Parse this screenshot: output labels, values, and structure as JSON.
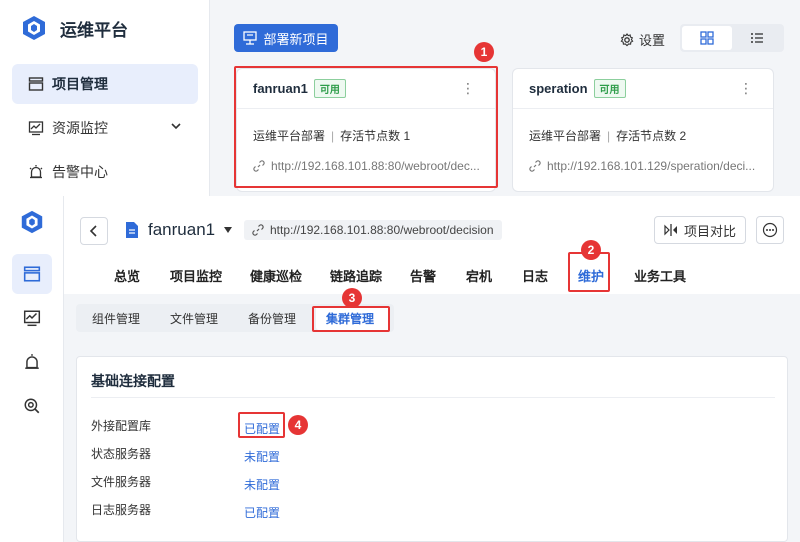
{
  "app": {
    "title": "运维平台"
  },
  "sidebar": {
    "items": [
      {
        "label": "项目管理",
        "icon": "project-icon"
      },
      {
        "label": "资源监控",
        "icon": "monitor-icon"
      },
      {
        "label": "告警中心",
        "icon": "alarm-icon"
      }
    ]
  },
  "toolbar": {
    "deploy_label": "部署新项目",
    "settings_label": "设置"
  },
  "project_cards": [
    {
      "name": "fanruan1",
      "status": "可用",
      "desc": "运维平台部署",
      "nodes": "存活节点数 1",
      "url": "http://192.168.101.88:80/webroot/dec..."
    },
    {
      "name": "speration",
      "status": "可用",
      "desc": "运维平台部署",
      "nodes": "存活节点数 2",
      "url": "http://192.168.101.129/speration/deci..."
    }
  ],
  "detail": {
    "project_name": "fanruan1",
    "url": "http://192.168.101.88:80/webroot/decision",
    "compare_label": "项目对比",
    "tabs": [
      "总览",
      "项目监控",
      "健康巡检",
      "链路追踪",
      "告警",
      "宕机",
      "日志",
      "维护",
      "业务工具"
    ],
    "active_tab": "维护",
    "subtabs": [
      "组件管理",
      "文件管理",
      "备份管理",
      "集群管理"
    ],
    "active_subtab": "集群管理",
    "config_title": "基础连接配置",
    "config_rows": [
      {
        "label": "外接配置库",
        "value": "已配置"
      },
      {
        "label": "状态服务器",
        "value": "未配置"
      },
      {
        "label": "文件服务器",
        "value": "未配置"
      },
      {
        "label": "日志服务器",
        "value": "已配置"
      }
    ]
  },
  "callouts": [
    "1",
    "2",
    "3",
    "4"
  ],
  "colors": {
    "accent": "#2f6bd8",
    "callout": "#e63535",
    "badge_green": "#2e9d4a"
  }
}
